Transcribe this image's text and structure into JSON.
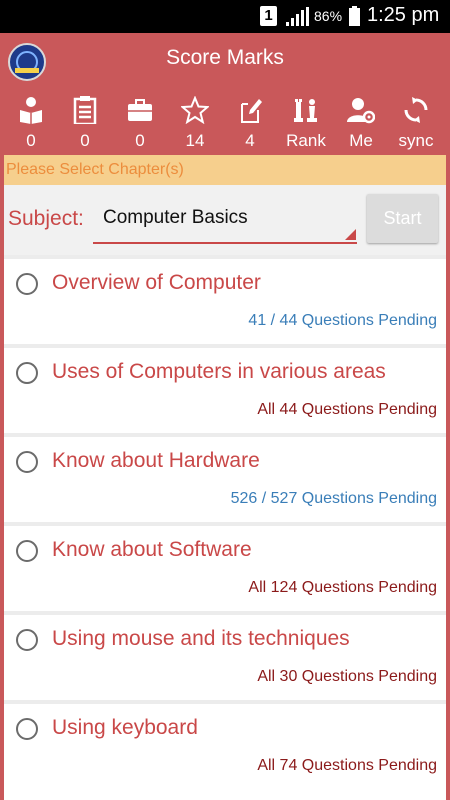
{
  "status_bar": {
    "sim_slot": "1",
    "battery_percent": "86%",
    "time": "1:25 pm"
  },
  "app": {
    "title": "Score Marks",
    "logo_icon": "institute-logo-icon"
  },
  "stats": [
    {
      "icon": "reader-icon",
      "value": "0"
    },
    {
      "icon": "clipboard-icon",
      "value": "0"
    },
    {
      "icon": "briefcase-icon",
      "value": "0"
    },
    {
      "icon": "star-icon",
      "value": "14"
    },
    {
      "icon": "edit-note-icon",
      "value": "4"
    },
    {
      "icon": "chess-pieces-icon",
      "value": "Rank"
    },
    {
      "icon": "user-settings-icon",
      "value": "Me"
    },
    {
      "icon": "sync-icon",
      "value": "sync"
    }
  ],
  "notice": "Please Select Chapter(s)",
  "subject": {
    "label": "Subject:",
    "selected": "Computer Basics",
    "start_label": "Start"
  },
  "chapters": [
    {
      "name": "Overview of Computer",
      "pending": "41 / 44 Questions Pending",
      "state": "partial"
    },
    {
      "name": "Uses of Computers in various areas",
      "pending": "All 44 Questions Pending",
      "state": "all"
    },
    {
      "name": "Know about Hardware",
      "pending": "526 / 527 Questions Pending",
      "state": "partial"
    },
    {
      "name": "Know about Software",
      "pending": "All 124 Questions Pending",
      "state": "all"
    },
    {
      "name": "Using mouse and its techniques",
      "pending": "All 30 Questions Pending",
      "state": "all"
    },
    {
      "name": "Using keyboard",
      "pending": "All 74 Questions Pending",
      "state": "all"
    }
  ],
  "colors": {
    "brand": "#c9585a",
    "accent_text": "#c94848",
    "partial_pending": "#3a7eb8",
    "all_pending": "#8b1a1a",
    "notice_bg": "#f6cf8d",
    "notice_text": "#ec8d3d"
  }
}
